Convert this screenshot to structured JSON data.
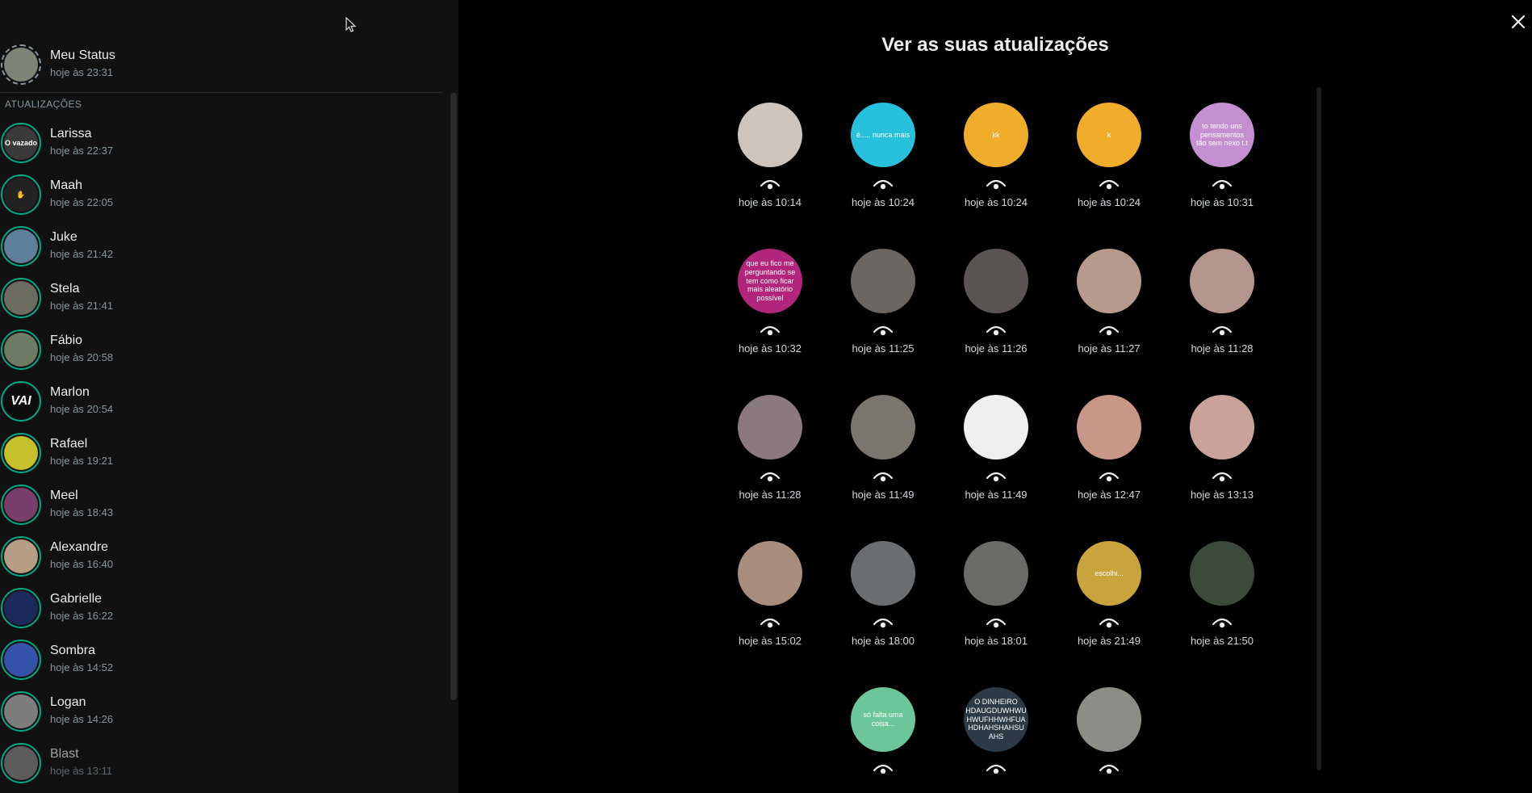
{
  "my_status": {
    "name": "Meu Status",
    "time": "hoje às 23:31"
  },
  "section_label": "ATUALIZAÇÕES",
  "updates": [
    {
      "name": "Larissa",
      "time": "hoje às 22:37",
      "bg": "#3a3a3a",
      "text": "O vazado"
    },
    {
      "name": "Maah",
      "time": "hoje às 22:05",
      "bg": "#222222",
      "text": "✋"
    },
    {
      "name": "Juke",
      "time": "hoje às 21:42",
      "bg": "#5d7f9a",
      "text": ""
    },
    {
      "name": "Stela",
      "time": "hoje às 21:41",
      "bg": "#6b6b60",
      "text": ""
    },
    {
      "name": "Fábio",
      "time": "hoje às 20:58",
      "bg": "#6e7a63",
      "text": ""
    },
    {
      "name": "Marlon",
      "time": "hoje às 20:54",
      "bg": "#0c0c0c",
      "text": "VAI"
    },
    {
      "name": "Rafael",
      "time": "hoje às 19:21",
      "bg": "#c6c12b",
      "text": ""
    },
    {
      "name": "Meel",
      "time": "hoje às 18:43",
      "bg": "#7a3e6c",
      "text": ""
    },
    {
      "name": "Alexandre",
      "time": "hoje às 16:40",
      "bg": "#b59e84",
      "text": ""
    },
    {
      "name": "Gabrielle",
      "time": "hoje às 16:22",
      "bg": "#1b2a5a",
      "text": ""
    },
    {
      "name": "Sombra",
      "time": "hoje às 14:52",
      "bg": "#3452a8",
      "text": ""
    },
    {
      "name": "Logan",
      "time": "hoje às 14:26",
      "bg": "#7d7d7d",
      "text": ""
    },
    {
      "name": "Blast",
      "time": "hoje às 13:11",
      "bg": "#5c5c5c",
      "text": ""
    }
  ],
  "main": {
    "title": "Ver as suas atualizações",
    "thumbs": [
      {
        "time": "hoje às 10:14",
        "bg": "#cfc4bd",
        "text": ""
      },
      {
        "time": "hoje às 10:24",
        "bg": "#27c1dd",
        "text": "é..... nunca mais"
      },
      {
        "time": "hoje às 10:24",
        "bg": "#f0ac2b",
        "text": "kk"
      },
      {
        "time": "hoje às 10:24",
        "bg": "#f0ac2b",
        "text": "k"
      },
      {
        "time": "hoje às 10:31",
        "bg": "#c590d1",
        "text": "to tendo uns pensamentos tão sem nexo t.t"
      },
      {
        "time": "hoje às 10:32",
        "bg": "#b1267b",
        "text": "que eu fico me perguntando se tem como ficar mais aleatório possível"
      },
      {
        "time": "hoje às 11:25",
        "bg": "#6a6560",
        "text": ""
      },
      {
        "time": "hoje às 11:26",
        "bg": "#5a5552",
        "text": ""
      },
      {
        "time": "hoje às 11:27",
        "bg": "#b69a8e",
        "text": ""
      },
      {
        "time": "hoje às 11:28",
        "bg": "#b4978c",
        "text": ""
      },
      {
        "time": "hoje às 11:28",
        "bg": "#8a7a80",
        "text": ""
      },
      {
        "time": "hoje às 11:49",
        "bg": "#7a756e",
        "text": ""
      },
      {
        "time": "hoje às 11:49",
        "bg": "#efefef",
        "text": ""
      },
      {
        "time": "hoje às 12:47",
        "bg": "#c99787",
        "text": ""
      },
      {
        "time": "hoje às 13:13",
        "bg": "#c9a39a",
        "text": ""
      },
      {
        "time": "hoje às 15:02",
        "bg": "#a88d7d",
        "text": ""
      },
      {
        "time": "hoje às 18:00",
        "bg": "#6b6e70",
        "text": ""
      },
      {
        "time": "hoje às 18:01",
        "bg": "#6a6a66",
        "text": ""
      },
      {
        "time": "hoje às 21:49",
        "bg": "#c9a43d",
        "text": "escolhi..."
      },
      {
        "time": "hoje às 21:50",
        "bg": "#3c4a3c",
        "text": ""
      },
      {
        "time": "",
        "bg": "",
        "text": ""
      },
      {
        "time": "",
        "bg": "#6bc79a",
        "text": "só falta uma coisa..."
      },
      {
        "time": "",
        "bg": "#2b3a44",
        "text": "O DINHEIRO HDAUGDUWHWU HWUFHHWHFUA HDHAHSHAHSU AHS"
      },
      {
        "time": "",
        "bg": "#8b8e86",
        "text": ""
      }
    ]
  },
  "icons": {
    "close": "close-icon",
    "eye": "eye-icon",
    "cursor": "cursor-icon"
  },
  "colors": {
    "accent": "#00a884",
    "sidebar_bg": "#111111",
    "main_bg": "#000000"
  }
}
